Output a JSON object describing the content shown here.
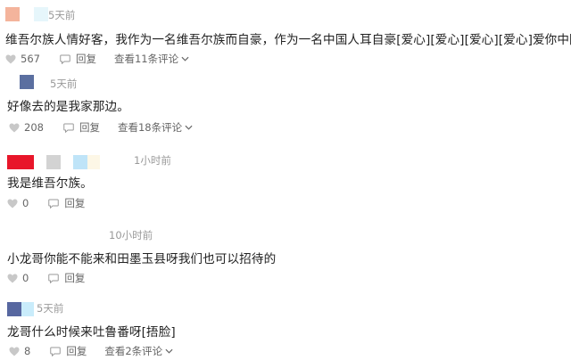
{
  "colors": {
    "like_icon": "#c8c8c8",
    "text": "#222222",
    "meta": "#999999",
    "action": "#666666"
  },
  "comments": [
    {
      "avatars": [
        "#f4b49c",
        "#e6f6fb"
      ],
      "time": "5天前",
      "text": "维吾尔族人情好客，我作为一名维吾尔族而自豪，作为一名中国人耳自豪[爱心][爱心][爱心][爱心]爱你中国",
      "likes": "567",
      "reply_label": "回复",
      "more_label": "查看11条评论"
    },
    {
      "avatars": [
        "#5b6fa0"
      ],
      "time": "5天前",
      "text": "好像去的是我家那边。",
      "likes": "208",
      "reply_label": "回复",
      "more_label": "查看18条评论"
    },
    {
      "avatars": [
        "#e8162a",
        "#d3d3d3",
        "#bfe4f8",
        "#fdf7e6"
      ],
      "time": "1小时前",
      "text": "我是维吾尔族。",
      "likes": "0",
      "reply_label": "回复",
      "more_label": ""
    },
    {
      "avatars": [],
      "time": "10小时前",
      "text": "小龙哥你能不能来和田墨玉县呀我们也可以招待的",
      "likes": "0",
      "reply_label": "回复",
      "more_label": ""
    },
    {
      "avatars": [
        "#5767a0",
        "#c9ecfb"
      ],
      "time": "5天前",
      "text": "龙哥什么时候来吐鲁番呀[捂脸]",
      "likes": "8",
      "reply_label": "回复",
      "more_label": "查看2条评论"
    }
  ]
}
